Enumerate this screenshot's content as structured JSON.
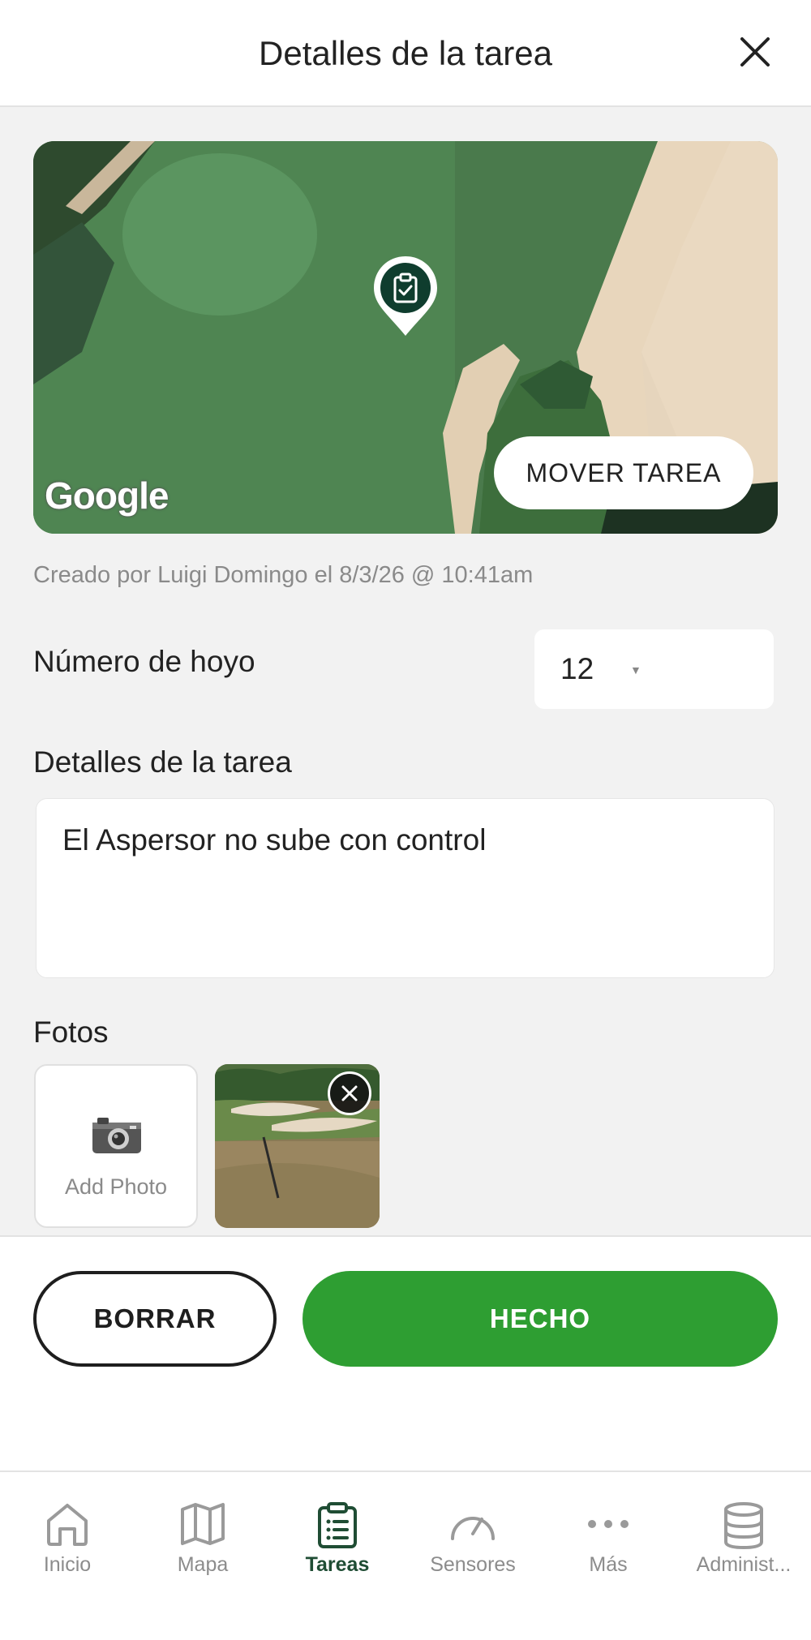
{
  "header": {
    "title": "Detalles de la tarea"
  },
  "map": {
    "move_label": "MOVER TAREA",
    "attribution": "Google"
  },
  "meta": {
    "created_text": "Creado por Luigi Domingo el 8/3/26 @ 10:41am"
  },
  "hole": {
    "label": "Número de hoyo",
    "value": "12"
  },
  "details": {
    "label": "Detalles de la tarea",
    "value": "El Aspersor no sube con control"
  },
  "photos": {
    "label": "Fotos",
    "add_label": "Add Photo"
  },
  "actions": {
    "delete_label": "BORRAR",
    "done_label": "HECHO"
  },
  "tabs": [
    {
      "label": "Inicio",
      "icon": "home-icon"
    },
    {
      "label": "Mapa",
      "icon": "map-icon"
    },
    {
      "label": "Tareas",
      "icon": "clipboard-icon",
      "active": true
    },
    {
      "label": "Sensores",
      "icon": "gauge-icon"
    },
    {
      "label": "Más",
      "icon": "more-icon"
    },
    {
      "label": "Administ...",
      "icon": "database-icon"
    }
  ],
  "colors": {
    "accent": "#2e9e32",
    "brand_dark": "#0f3d2e",
    "active_tab": "#1f4d34"
  }
}
